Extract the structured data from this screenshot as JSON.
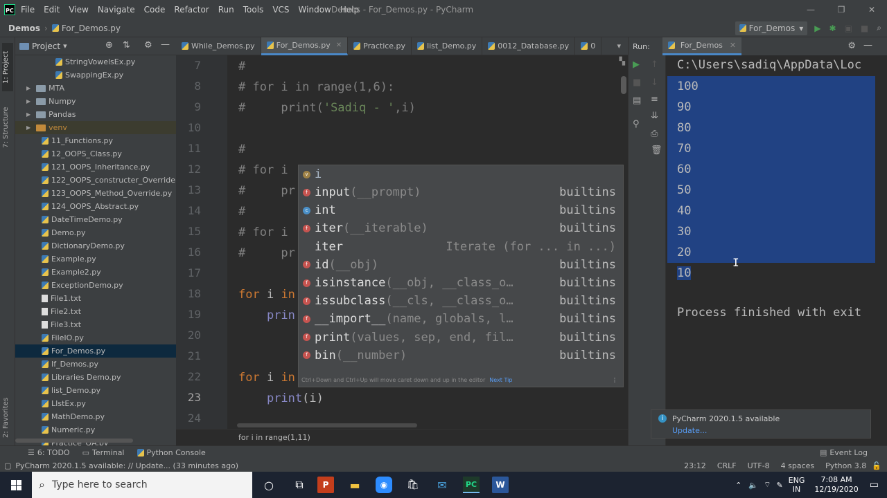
{
  "titlebar": {
    "app_icon": "PC",
    "menus": [
      "File",
      "Edit",
      "View",
      "Navigate",
      "Code",
      "Refactor",
      "Run",
      "Tools",
      "VCS",
      "Window",
      "Help"
    ],
    "title": "Demos - For_Demos.py - PyCharm"
  },
  "navbar": {
    "crumbs": [
      "Demos",
      "For_Demos.py"
    ],
    "run_config": "For_Demos"
  },
  "project": {
    "title": "Project",
    "items": [
      {
        "label": "StringVowelsEx.py",
        "type": "file",
        "indent": 2
      },
      {
        "label": "SwappingEx.py",
        "type": "file",
        "indent": 2
      },
      {
        "label": "MTA",
        "type": "folder",
        "indent": 1
      },
      {
        "label": "Numpy",
        "type": "folder",
        "indent": 1
      },
      {
        "label": "Pandas",
        "type": "folder",
        "indent": 1
      },
      {
        "label": "venv",
        "type": "venv",
        "indent": 1
      },
      {
        "label": "11_Functions.py",
        "type": "file",
        "indent": 1
      },
      {
        "label": "12_OOPS_Class.py",
        "type": "file",
        "indent": 1
      },
      {
        "label": "121_OOPS_Inheritance.py",
        "type": "file",
        "indent": 1
      },
      {
        "label": "122_OOPS_constructer_Override.py",
        "type": "file",
        "indent": 1
      },
      {
        "label": "123_OOPS_Method_Override.py",
        "type": "file",
        "indent": 1
      },
      {
        "label": "124_OOPS_Abstract.py",
        "type": "file",
        "indent": 1
      },
      {
        "label": "DateTimeDemo.py",
        "type": "file",
        "indent": 1
      },
      {
        "label": "Demo.py",
        "type": "file",
        "indent": 1
      },
      {
        "label": "DictionaryDemo.py",
        "type": "file",
        "indent": 1
      },
      {
        "label": "Example.py",
        "type": "file",
        "indent": 1
      },
      {
        "label": "Example2.py",
        "type": "file",
        "indent": 1
      },
      {
        "label": "ExceptionDemo.py",
        "type": "file",
        "indent": 1
      },
      {
        "label": "File1.txt",
        "type": "txt",
        "indent": 1
      },
      {
        "label": "File2.txt",
        "type": "txt",
        "indent": 1
      },
      {
        "label": "File3.txt",
        "type": "txt",
        "indent": 1
      },
      {
        "label": "FileIO.py",
        "type": "file",
        "indent": 1
      },
      {
        "label": "For_Demos.py",
        "type": "file",
        "indent": 1,
        "selected": true
      },
      {
        "label": "If_Demos.py",
        "type": "file",
        "indent": 1
      },
      {
        "label": "Libraries Demo.py",
        "type": "file",
        "indent": 1
      },
      {
        "label": "list_Demo.py",
        "type": "file",
        "indent": 1
      },
      {
        "label": "LIstEx.py",
        "type": "file",
        "indent": 1
      },
      {
        "label": "MathDemo.py",
        "type": "file",
        "indent": 1
      },
      {
        "label": "Numeric.py",
        "type": "file",
        "indent": 1
      },
      {
        "label": "Practice_QA.py",
        "type": "file",
        "indent": 1
      }
    ]
  },
  "tabs": [
    "While_Demos.py",
    "For_Demos.py",
    "Practice.py",
    "list_Demo.py",
    "0012_Database.py",
    "0"
  ],
  "editor": {
    "lines": [
      {
        "n": "7",
        "text": "#"
      },
      {
        "n": "8",
        "text": "# for i in range(1,6):"
      },
      {
        "n": "9",
        "text": "#     print('Sadiq - ',i)"
      },
      {
        "n": "10",
        "text": ""
      },
      {
        "n": "11",
        "text": "#"
      },
      {
        "n": "12",
        "text": "# for i"
      },
      {
        "n": "13",
        "text": "#     pr"
      },
      {
        "n": "14",
        "text": "#"
      },
      {
        "n": "15",
        "text": "# for i"
      },
      {
        "n": "16",
        "text": "#     pr"
      },
      {
        "n": "17",
        "text": ""
      },
      {
        "n": "18",
        "text": "for i in"
      },
      {
        "n": "19",
        "text": "    prin"
      },
      {
        "n": "20",
        "text": ""
      },
      {
        "n": "21",
        "text": ""
      },
      {
        "n": "22",
        "text": "for i in"
      },
      {
        "n": "23",
        "text": "    print(i)"
      },
      {
        "n": "24",
        "text": ""
      }
    ]
  },
  "completion": {
    "typed": "i",
    "items": [
      {
        "name": "input",
        "sig": "(__prompt)",
        "src": "builtins",
        "icon": "f"
      },
      {
        "name": "int",
        "sig": "",
        "src": "builtins",
        "icon": "c"
      },
      {
        "name": "iter",
        "sig": "(__iterable)",
        "src": "builtins",
        "icon": "f"
      },
      {
        "name": "iter",
        "sig": "",
        "src": "Iterate (for ... in ...)",
        "icon": ""
      },
      {
        "name": "id",
        "sig": "(__obj)",
        "src": "builtins",
        "icon": "f"
      },
      {
        "name": "isinstance",
        "sig": "(__obj, __class_o…",
        "src": "builtins",
        "icon": "f"
      },
      {
        "name": "issubclass",
        "sig": "(__cls, __class_o…",
        "src": "builtins",
        "icon": "f"
      },
      {
        "name": "__import__",
        "sig": "(name, globals, l…",
        "src": "builtins",
        "icon": "f"
      },
      {
        "name": "print",
        "sig": "(values, sep, end, fil…",
        "src": "builtins",
        "icon": "f"
      },
      {
        "name": "bin",
        "sig": "(__number)",
        "src": "builtins",
        "icon": "f"
      }
    ],
    "hint": "Ctrl+Down and Ctrl+Up will move caret down and up in the editor",
    "hint_link": "Next Tip"
  },
  "breadcrumb": "for i in range(1,11)",
  "run": {
    "label": "Run:",
    "tab": "For_Demos",
    "path": "C:\\Users\\sadiq\\AppData\\Loc",
    "output": [
      "100",
      "90",
      "80",
      "70",
      "60",
      "50",
      "40",
      "30",
      "20",
      "10"
    ],
    "finished": "Process finished with exit"
  },
  "notification": {
    "title": "PyCharm 2020.1.5 available",
    "link": "Update..."
  },
  "bottomtabs": [
    "6: TODO",
    "Terminal",
    "Python Console"
  ],
  "eventlog": "Event Log",
  "status": {
    "message": "PyCharm 2020.1.5 available: // Update... (33 minutes ago)",
    "pos": "23:12",
    "le": "CRLF",
    "enc": "UTF-8",
    "indent": "4 spaces",
    "interp": "Python 3.8"
  },
  "taskbar": {
    "search": "Type here to search",
    "lang1": "ENG",
    "lang2": "IN",
    "time": "7:08 AM",
    "date": "12/19/2020"
  },
  "side_labels": {
    "left_top": "1: Project",
    "left_mid": "7: Structure",
    "left_bot": "2: Favorites"
  },
  "colors": {
    "accent": "#4a88c7",
    "selection": "#214283",
    "comment": "#808080",
    "keyword": "#cc7832"
  }
}
